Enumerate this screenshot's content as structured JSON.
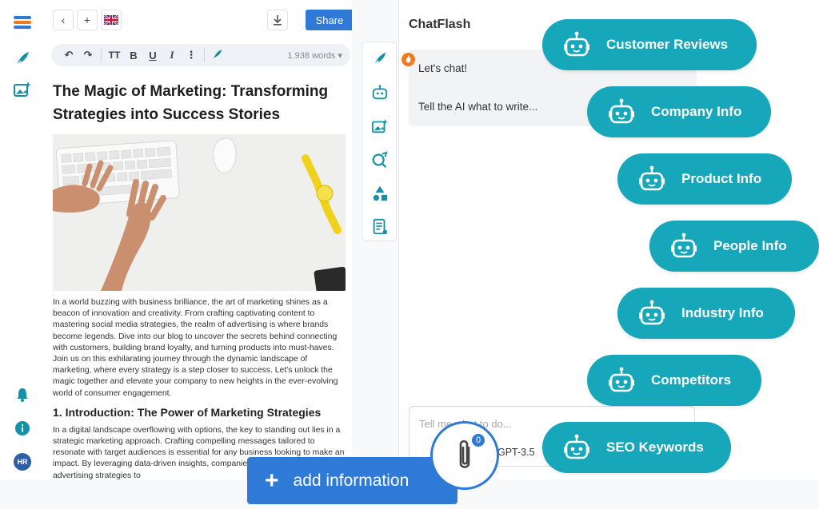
{
  "rail": {
    "items": [
      "hamburger-menu",
      "write-feather",
      "image-ai",
      "notifications",
      "info",
      "profile"
    ],
    "avatar_initials": "HR"
  },
  "editor": {
    "back_label": "‹",
    "add_label": "+",
    "share_label": "Share",
    "word_count": "1.938 words",
    "toolbar": [
      "undo",
      "redo",
      "text-size",
      "B",
      "U",
      "I",
      "more",
      "ai-write"
    ],
    "title": "The Magic of Marketing: Transforming Strategies into Success Stories",
    "intro": "In a world buzzing with business brilliance, the art of marketing shines as a beacon of innovation and creativity. From crafting captivating content to mastering social media strategies, the realm of advertising is where brands become legends. Dive into our blog to uncover the secrets behind connecting with customers, building brand loyalty, and turning products into must-haves. Join us on this exhilarating journey through the dynamic landscape of marketing, where every strategy is a step closer to success. Let's unlock the magic together and elevate your company to new heights in the ever-evolving world of consumer engagement.",
    "section_heading": "1. Introduction: The Power of Marketing Strategies",
    "section_text": "In a digital landscape overflowing with options, the key to standing out lies in a strategic marketing approach. Crafting compelling messages tailored to resonate with target audiences is essential for any business looking to make an impact. By leveraging data-driven insights, companies can refine their advertising strategies to"
  },
  "chat": {
    "title": "ChatFlash",
    "greeting": "Let's chat!",
    "prompt_hint": "Tell the AI what to write...",
    "input_placeholder": "Tell me what to do...",
    "model": "GPT-3.5"
  },
  "pills": [
    "Customer Reviews",
    "Company Info",
    "Product Info",
    "People Info",
    "Industry Info",
    "Competitors",
    "SEO Keywords"
  ],
  "add_information": {
    "label": "add information",
    "attachment_count": "0"
  },
  "colors": {
    "accent_blue": "#2f7ad6",
    "pill_teal": "#17a7bb",
    "icon_teal": "#1591a6",
    "fire_orange": "#f47a20"
  }
}
